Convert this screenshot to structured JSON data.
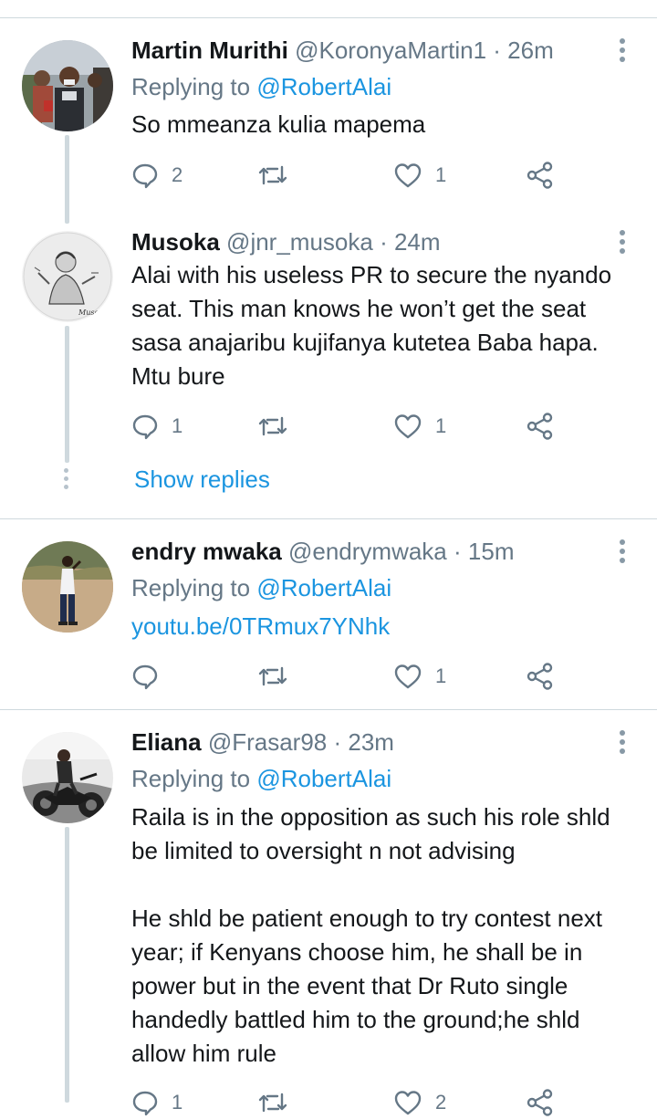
{
  "tweets": [
    {
      "name": "Martin Murithi",
      "handle": "@KoronyaMartin1",
      "time": "· 26m",
      "replying_label": "Replying to",
      "replying_handle": "@RobertAlai",
      "text": "So mmeanza kulia mapema",
      "reply_count": "2",
      "retweet_count": "",
      "like_count": "1"
    },
    {
      "name": "Musoka",
      "handle": "@jnr_musoka",
      "time": "· 24m",
      "text": "Alai with his useless PR to secure the nyando seat. This man knows he won’t get the seat sasa anajaribu kujifanya kutetea Baba hapa. Mtu bure",
      "reply_count": "1",
      "retweet_count": "",
      "like_count": "1",
      "avatar_caption": "Musoka"
    },
    {
      "name": "endry mwaka",
      "handle": "@endrymwaka",
      "time": "· 15m",
      "replying_label": "Replying to",
      "replying_handle": "@RobertAlai",
      "text": "youtu.be/0TRmux7YNhk",
      "reply_count": "",
      "retweet_count": "",
      "like_count": "1"
    },
    {
      "name": "Eliana",
      "handle": "@Frasar98",
      "time": "· 23m",
      "replying_label": "Replying to",
      "replying_handle": "@RobertAlai",
      "text_p1": "Raila is in the opposition as such his role shld be limited to oversight n not advising",
      "text_p2": "He shld be patient enough to try contest next year; if Kenyans choose him, he shall be in power but in the event that Dr Ruto single handedly battled him to the ground;he shld allow him rule",
      "reply_count": "1",
      "retweet_count": "",
      "like_count": "2"
    }
  ],
  "show_replies": "Show replies",
  "icons": {
    "reply": "reply-icon",
    "retweet": "retweet-icon",
    "like": "heart-icon",
    "share": "share-icon",
    "more": "more-vertical-icon"
  },
  "colors": {
    "link": "#1b95e0",
    "secondary": "#657786",
    "divider": "#cfd9de",
    "text": "#14171a"
  }
}
